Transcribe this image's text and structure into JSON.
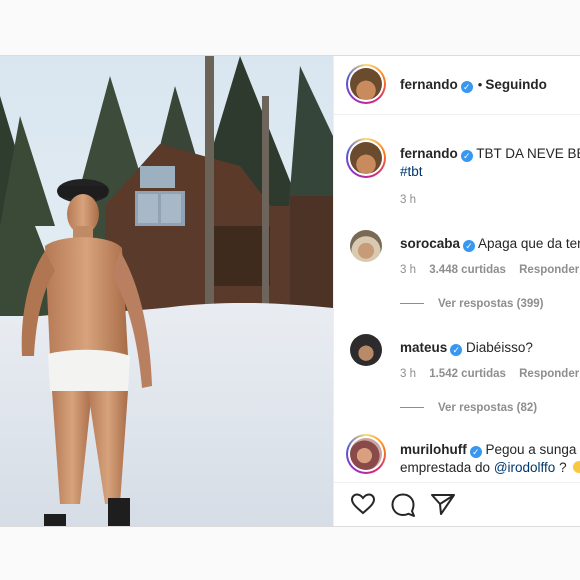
{
  "post": {
    "author": "fernando",
    "follow_status": "Seguindo",
    "caption_text": "TBT DA NEVE BB",
    "caption_hashtag": "#tbt",
    "caption_time": "3 h"
  },
  "comments": [
    {
      "user": "sorocaba",
      "text": "Apaga que da ter",
      "time": "3 h",
      "likes": "3.448 curtidas",
      "reply_label": "Responder",
      "view_replies": "Ver respostas (399)"
    },
    {
      "user": "mateus",
      "text": "Diabéisso?",
      "time": "3 h",
      "likes": "1.542 curtidas",
      "reply_label": "Responder",
      "view_replies": "Ver respostas (82)"
    },
    {
      "user": "murilohuff",
      "text_line1": "Pegou a sunga",
      "text_line2_prefix": "emprestada do ",
      "mention": "@irodolffo",
      "text_line2_suffix": " ?"
    }
  ],
  "icons": {
    "verified": "verified-badge-icon",
    "like": "heart-icon",
    "comment": "comment-bubble-icon",
    "share": "paper-plane-icon"
  },
  "colors": {
    "verified_blue": "#3897f0",
    "link_blue": "#00376b",
    "muted_gray": "#8e8e8e",
    "text": "#262626"
  }
}
